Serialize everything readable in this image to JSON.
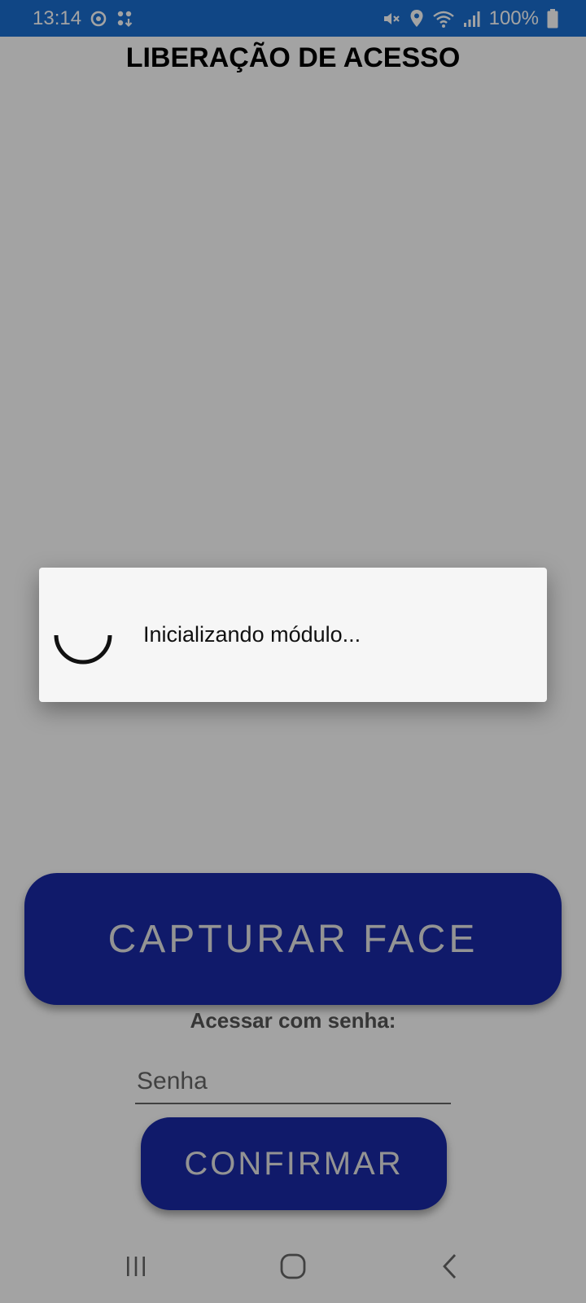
{
  "status_bar": {
    "time": "13:14",
    "battery_percent": "100%",
    "background_color": "#1a6ed0",
    "left_icons": [
      "sync-icon",
      "apps-download-icon"
    ],
    "right_icons": [
      "mute-icon",
      "location-icon",
      "wifi-icon",
      "signal-icon",
      "battery-icon"
    ]
  },
  "app": {
    "title": "LIBERAÇÃO DE ACESSO",
    "capture_button_label": "CAPTURAR FACE",
    "password_label": "Acessar com senha:",
    "password_placeholder": "Senha",
    "password_value": "",
    "confirm_button_label": "CONFIRMAR",
    "button_color": "#1a2aa6"
  },
  "dialog": {
    "message": "Inicializando módulo..."
  },
  "nav_bar": {
    "buttons": [
      "recent-apps-icon",
      "home-icon",
      "back-icon"
    ]
  }
}
